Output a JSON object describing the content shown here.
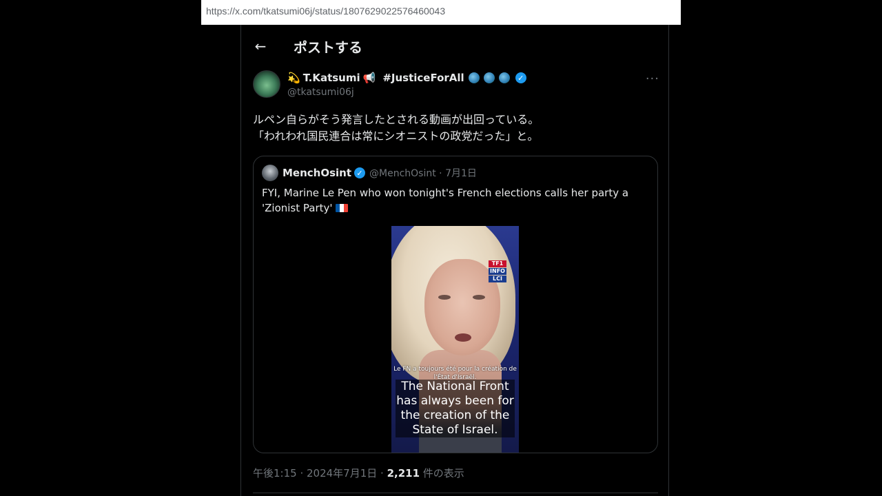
{
  "browser": {
    "url": "https://x.com/tkatsumi06j/status/1807629022576460043"
  },
  "header": {
    "title": "ポストする"
  },
  "post": {
    "author": {
      "name_prefix_emoji": "💫",
      "name": "T.Katsumi",
      "name_suffix_emoji": "📢",
      "tag": "#JusticeForAll",
      "handle": "@tkatsumi06j"
    },
    "text_line1": "ルペン自らがそう発言したとされる動画が出回っている。",
    "text_line2": "「われわれ国民連合は常にシオニストの政党だった」と。",
    "timestamp": "午後1:15 · 2024年7月1日 · ",
    "views_count": "2,211",
    "views_label": " 件の表示"
  },
  "quote": {
    "name": "MenchOsint",
    "handle_date": "@MenchOsint · 7月1日",
    "text": "FYI, Marine Le Pen who won tonight's French elections calls her party a 'Zionist Party'",
    "video": {
      "logo_lines": [
        "TF1",
        "INFO",
        "LCI"
      ],
      "subtitle_fr": "Le FN a toujours été pour la création de l'État d'Israël.",
      "subtitle_en": "The National Front has always been for the creation of the State of Israel."
    }
  },
  "colors": {
    "background": "#000000",
    "text": "#e7e9ea",
    "muted": "#71767b",
    "border": "#2f3336",
    "verified": "#1d9bf0"
  }
}
